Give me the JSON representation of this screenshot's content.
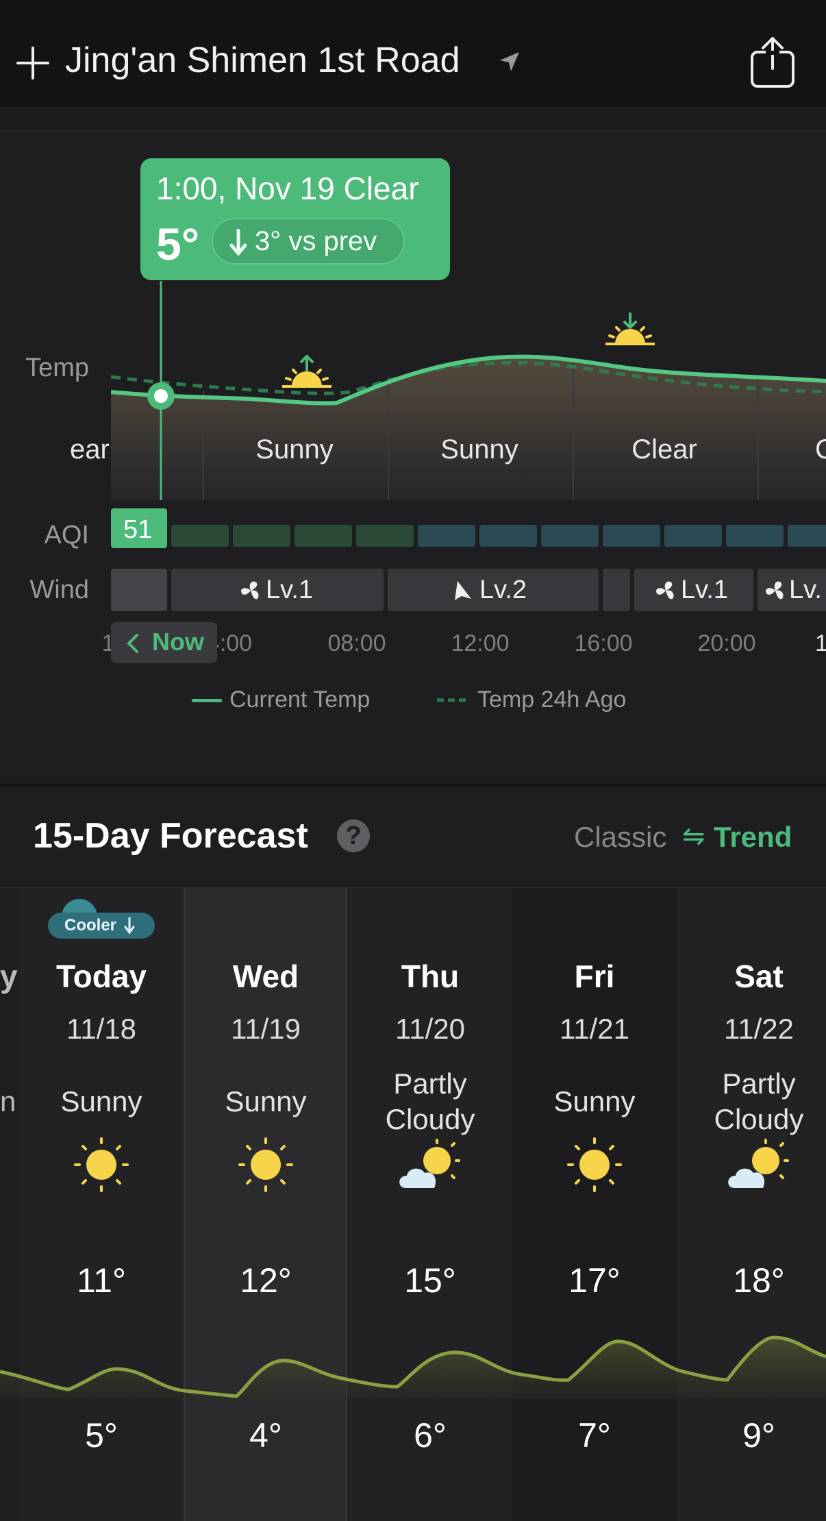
{
  "header": {
    "location": "Jing'an Shimen 1st Road",
    "icons": [
      "plus-icon",
      "location-arrow-icon",
      "share-icon"
    ]
  },
  "hourly": {
    "tooltip": {
      "title": "1:00, Nov 19 Clear",
      "temp": "5°",
      "compare": "3° vs prev"
    },
    "row_labels": {
      "temp": "Temp",
      "aqi": "AQI",
      "wind": "Wind"
    },
    "conditions": [
      "ear",
      "Sunny",
      "Sunny",
      "Clear",
      "C"
    ],
    "aqi_current": "51",
    "wind": [
      "Lv.1",
      "Lv.2",
      "Lv.1",
      "Lv."
    ],
    "now_label": "Now",
    "times": [
      "1",
      "4:00",
      "08:00",
      "12:00",
      "16:00",
      "20:00",
      "1"
    ],
    "legend": {
      "current": "Current Temp",
      "past": "Temp 24h Ago"
    }
  },
  "forecast": {
    "title": "15-Day Forecast",
    "help": "?",
    "toggle": {
      "classic": "Classic",
      "trend": "Trend",
      "icon": "⇋"
    },
    "badge": "Cooler",
    "partial_left": {
      "name": "y",
      "cond": "n"
    },
    "days": [
      {
        "name": "Today",
        "date": "11/18",
        "cond": "Sunny",
        "icon": "sun-icon",
        "high": "11°",
        "low": "5°"
      },
      {
        "name": "Wed",
        "date": "11/19",
        "cond": "Sunny",
        "icon": "sun-icon",
        "high": "12°",
        "low": "4°"
      },
      {
        "name": "Thu",
        "date": "11/20",
        "cond": "Partly\nCloudy",
        "icon": "partly-cloudy-icon",
        "high": "15°",
        "low": "6°"
      },
      {
        "name": "Fri",
        "date": "11/21",
        "cond": "Sunny",
        "icon": "sun-icon",
        "high": "17°",
        "low": "7°"
      },
      {
        "name": "Sat",
        "date": "11/22",
        "cond": "Partly\nCloudy",
        "icon": "partly-cloudy-icon",
        "high": "18°",
        "low": "9°"
      }
    ]
  },
  "colors": {
    "accent": "#4cbb7a",
    "background": "#1e1e21",
    "sun": "#f7d54a"
  }
}
